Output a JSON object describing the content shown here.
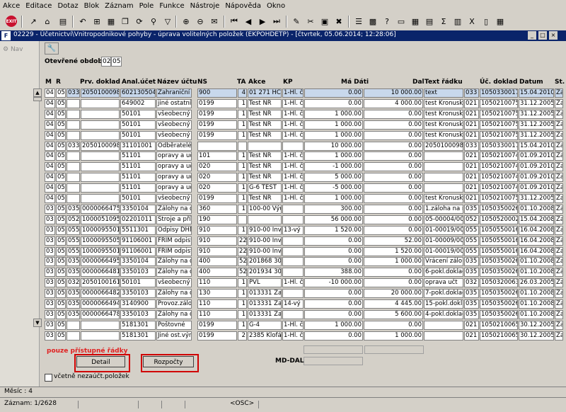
{
  "menu": [
    "Akce",
    "Editace",
    "Dotaz",
    "Blok",
    "Záznam",
    "Pole",
    "Funkce",
    "Nástroje",
    "Nápověda",
    "Okno"
  ],
  "toolbar": {
    "exit_label": "EXIT"
  },
  "window": {
    "title": "02229 - Účetnictví\\Vnitropodnikové pohyby - úprava volitelných položek (EKPOHDETP) - [čtvrtek, 05.06.2014; 12:28:06]"
  },
  "nav": {
    "label": "Nav"
  },
  "period": {
    "label": "Otevřené období",
    "value1": "02",
    "value2": "05"
  },
  "columns": [
    "M",
    "R",
    "",
    "Prv. doklad",
    "Anal.účet",
    "Název účtu",
    "NS",
    "TA",
    "Akce",
    "KP",
    "Má Dáti",
    "Dal",
    "Text řádku",
    "Úč. doklad",
    "Datum",
    "St."
  ],
  "rows": [
    [
      "04",
      "05",
      "033",
      "2050100098",
      "602130504",
      "Zahraniční s",
      "900",
      "4",
      "01 271 HČ-z",
      "1-Hl. č",
      "0.00",
      "10 000.00",
      "text",
      "033",
      "1050330017",
      "15.04.2010",
      "Za"
    ],
    [
      "04",
      "05",
      "",
      "",
      "649002",
      "jiné ostatní v",
      "0199",
      "1",
      "Test NR",
      "1-Hl. č",
      "0.00",
      "4 000.00",
      "test Kronuska",
      "021",
      "1050210075",
      "31.12.2005",
      "Za"
    ],
    [
      "04",
      "05",
      "",
      "",
      "50101",
      "všeobecný",
      "0199",
      "1",
      "Test NR",
      "1-Hl. č",
      "1 000.00",
      "0.00",
      "test Kronuska",
      "021",
      "1050210075",
      "31.12.2005",
      "Za"
    ],
    [
      "04",
      "05",
      "",
      "",
      "50101",
      "všeobecný",
      "0199",
      "1",
      "Test NR",
      "1-Hl. č",
      "1 000.00",
      "0.00",
      "test Kronuska",
      "021",
      "1050210075",
      "31.12.2005",
      "Za"
    ],
    [
      "04",
      "05",
      "",
      "",
      "50101",
      "všeobecný",
      "0199",
      "1",
      "Test NR",
      "1-Hl. č",
      "1 000.00",
      "0.00",
      "test Kronuska",
      "021",
      "1050210075",
      "31.12.2005",
      "Za"
    ],
    [
      "04",
      "05",
      "033",
      "2050100098",
      "31101001",
      "Odběratelé -",
      "",
      "",
      "",
      "",
      "10 000.00",
      "0.00",
      "2050100098 (",
      "033",
      "1050330017",
      "15.04.2010",
      "Za"
    ],
    [
      "04",
      "05",
      "",
      "",
      "51101",
      "opravy a ud",
      "101",
      "1",
      "Test NR",
      "1-Hl. č",
      "1 000.00",
      "0.00",
      "",
      "021",
      "1050210074",
      "01.09.2010",
      "Za"
    ],
    [
      "04",
      "05",
      "",
      "",
      "51101",
      "opravy a ud",
      "020",
      "1",
      "Test NR",
      "1-Hl. č",
      "-1 000.00",
      "0.00",
      "",
      "021",
      "1050210074",
      "01.09.2010",
      "Za"
    ],
    [
      "04",
      "05",
      "",
      "",
      "51101",
      "opravy a ud",
      "020",
      "1",
      "Test NR",
      "1-Hl. č",
      "5 000.00",
      "0.00",
      "",
      "021",
      "1050210074",
      "01.09.2010",
      "Za"
    ],
    [
      "04",
      "05",
      "",
      "",
      "51101",
      "opravy a ud",
      "020",
      "1",
      "G-6 TEST",
      "1-Hl. č",
      "-5 000.00",
      "0.00",
      "",
      "021",
      "1050210074",
      "01.09.2010",
      "Za"
    ],
    [
      "04",
      "05",
      "",
      "",
      "50101",
      "všeobecný",
      "0199",
      "1",
      "Test NR",
      "1-Hl. č",
      "1 000.00",
      "0.00",
      "test Kronuska",
      "021",
      "1050210075",
      "31.12.2005",
      "Za"
    ],
    [
      "03",
      "05",
      "035",
      "0000066475",
      "3350104",
      "Zálohy na d",
      "360",
      "1",
      "100-00 Výu",
      "",
      "300.00",
      "0.00",
      "1.záloha na n",
      "035",
      "1050350026",
      "01.10.2008",
      "Za"
    ],
    [
      "03",
      "05",
      "052",
      "1000051095",
      "02201011",
      "Stroje a přís",
      "190",
      "",
      "",
      "",
      "56 000.00",
      "0.00",
      "05-00004/000",
      "052",
      "1050520002",
      "15.04.2008",
      "Za"
    ],
    [
      "03",
      "05",
      "055",
      "1000095501",
      "5511301",
      "Odpisy DHM",
      "910",
      "1",
      "910-00 Inve",
      "13-vý",
      "1 520.00",
      "0.00",
      "01-00019/000",
      "055",
      "1050550016",
      "16.04.2008",
      "Za"
    ],
    [
      "03",
      "05",
      "055",
      "1000095505",
      "91106001",
      "FRIM odpisy",
      "910",
      "22",
      "910-00 Inve",
      "",
      "0.00",
      "52.00",
      "01-00009/000",
      "055",
      "1050550016",
      "16.04.2008",
      "Za"
    ],
    [
      "03",
      "05",
      "055",
      "1000095501",
      "91106001",
      "FRIM odpisy",
      "910",
      "22",
      "910-00 Inve",
      "",
      "0.00",
      "1 520.00",
      "01-00019/000",
      "055",
      "1050550016",
      "16.04.2008",
      "Za"
    ],
    [
      "03",
      "05",
      "035",
      "0000066495",
      "3350104",
      "Zálohy na d",
      "400",
      "52",
      "201868 305",
      "",
      "0.00",
      "1 000.00",
      "Vrácení zálo",
      "035",
      "1050350026",
      "01.10.2008",
      "Za"
    ],
    [
      "03",
      "05",
      "035",
      "0000066481",
      "3350103",
      "Zálohy na c",
      "400",
      "52",
      "201934 301",
      "",
      "388.00",
      "0.00",
      "6-pokl.doklad",
      "035",
      "1050350026",
      "01.10.2008",
      "Za"
    ],
    [
      "03",
      "05",
      "032",
      "2050100161",
      "50101",
      "všeobecný",
      "110",
      "1",
      "PVL",
      "1-Hl. č",
      "-10 000.00",
      "0.00",
      "oprava učt",
      "032",
      "1050320063",
      "26.03.2005",
      "Za"
    ],
    [
      "03",
      "05",
      "035",
      "0000066482",
      "3350103",
      "Zálohy na c",
      "130",
      "1",
      "013331 Zah",
      "",
      "0.00",
      "20 000.00",
      "7-pokl.doklad",
      "035",
      "1050350026",
      "01.10.2008",
      "Za"
    ],
    [
      "03",
      "05",
      "035",
      "0000066494",
      "3140900",
      "Provoz.zálo",
      "110",
      "1",
      "013331 Zah",
      "14-vý",
      "0.00",
      "4 445.00",
      "15-pokl.doklac",
      "035",
      "1050350026",
      "01.10.2008",
      "Za"
    ],
    [
      "03",
      "05",
      "035",
      "0000066478",
      "3350103",
      "Zálohy na c",
      "110",
      "1",
      "013331 Zah",
      "",
      "0.00",
      "5 600.00",
      "4-pokl.doklad",
      "035",
      "1050350026",
      "01.10.2008",
      "Za"
    ],
    [
      "03",
      "05",
      "",
      "",
      "5181301",
      "Poštovné",
      "0199",
      "1",
      "G-4",
      "1-Hl. č",
      "1 000.00",
      "0.00",
      "",
      "021",
      "1050210065",
      "30.12.2005",
      "Za"
    ],
    [
      "03",
      "05",
      "",
      "",
      "5181301",
      "Jiné ost.výn",
      "0199",
      "2",
      "2385 Klofáč",
      "1-Hl. č",
      "0.00",
      "1 000.00",
      "",
      "021",
      "1050210065",
      "30.12.2005",
      "Za"
    ]
  ],
  "hint": "pouze přístupné řádky",
  "buttons": {
    "detail": "Detail",
    "rozpocty": "Rozpočty"
  },
  "md_dal_label": "MD-DAL",
  "checkbox": {
    "label": "včetně nezaúčt.položek"
  },
  "status": {
    "line1": "Měsíc : 4",
    "record": "Záznam: 1/2628",
    "osc": "<OSC>"
  }
}
